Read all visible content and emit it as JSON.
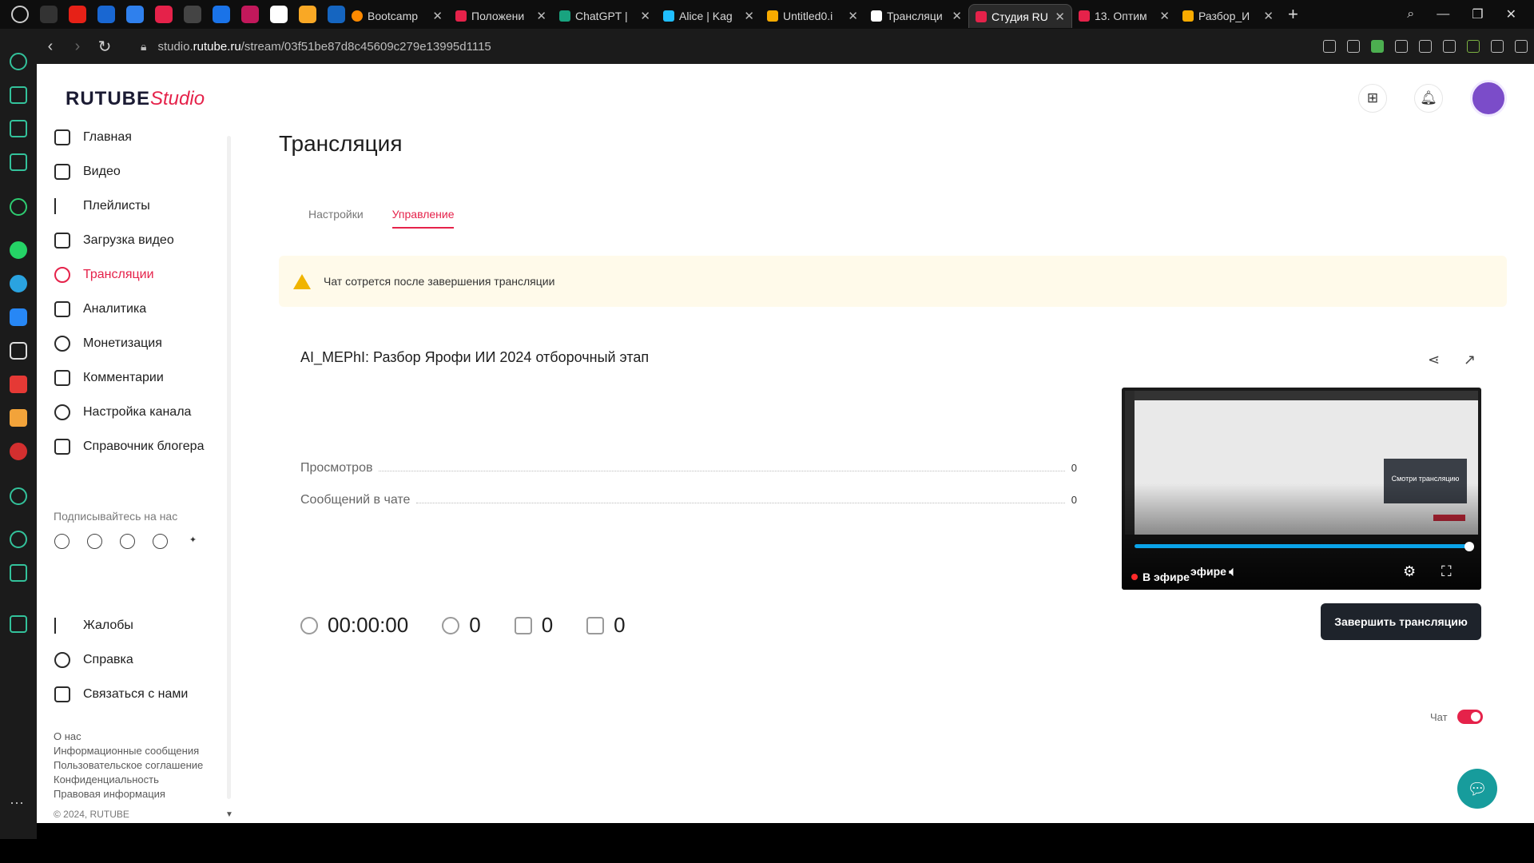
{
  "browser": {
    "tabs": [
      {
        "label": "Bootcamp",
        "color": "#ff8a00"
      },
      {
        "label": "Положени",
        "color": "#e5224a"
      },
      {
        "label": "ChatGPT | ",
        "color": "#19a37f"
      },
      {
        "label": "Alice | Kag",
        "color": "#20beff"
      },
      {
        "label": "Untitled0.i",
        "color": "#f9ab00"
      },
      {
        "label": "Трансляци",
        "color": "#ffffff"
      },
      {
        "label": "Студия RU",
        "color": "#e5224a"
      },
      {
        "label": "13. Оптим",
        "color": "#e5224a"
      },
      {
        "label": "Разбор_И",
        "color": "#f9ab00"
      }
    ],
    "url_prefix": "studio.",
    "url_domain": "rutube.ru",
    "url_path": "/stream/03f51be87d8c45609c279e13995d1115"
  },
  "logo": {
    "brand": "RUTUBE",
    "studio": "Studio"
  },
  "sidebar": {
    "items": [
      {
        "label": "Главная"
      },
      {
        "label": "Видео"
      },
      {
        "label": "Плейлисты"
      },
      {
        "label": "Загрузка видео"
      },
      {
        "label": "Трансляции"
      },
      {
        "label": "Аналитика"
      },
      {
        "label": "Монетизация"
      },
      {
        "label": "Комментарии"
      },
      {
        "label": "Настройка канала"
      },
      {
        "label": "Справочник блогера"
      }
    ],
    "follow_title": "Подписывайтесь на нас",
    "social": [
      "vk",
      "ok",
      "tg",
      "viber",
      "✦"
    ],
    "items2": [
      {
        "label": "Жалобы"
      },
      {
        "label": "Справка"
      },
      {
        "label": "Связаться с нами"
      }
    ],
    "footer_links": [
      "О нас",
      "Информационные сообщения",
      "Пользовательское соглашение",
      "Конфиденциальность",
      "Правовая информация"
    ],
    "copyright": "© 2024, RUTUBE"
  },
  "main": {
    "title": "Трансляция",
    "tabs": [
      {
        "label": "Настройки"
      },
      {
        "label": "Управление"
      }
    ],
    "warning": "Чат сотрется после завершения трансляции",
    "stream_title": "AI_MEPhI: Разбор Ярофи ИИ 2024 отборочный этап",
    "stats": [
      {
        "label": "Просмотров",
        "value": "0"
      },
      {
        "label": "Сообщений в чате",
        "value": "0"
      }
    ],
    "counters": {
      "duration": "00:00:00",
      "viewers": "0",
      "likes": "0",
      "dislikes": "0"
    },
    "player": {
      "live_label": "В эфире",
      "live_label_echo": "эфире",
      "mini_card_text": "Смотри трансляцию"
    },
    "end_button": "Завершить трансляцию",
    "chat_label": "Чат"
  }
}
